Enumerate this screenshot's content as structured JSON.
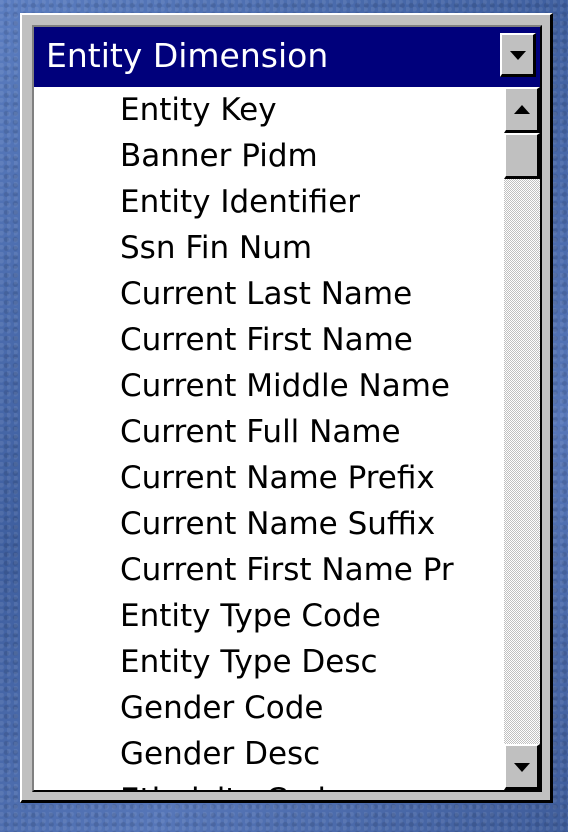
{
  "combo": {
    "selected": "Entity Dimension"
  },
  "list": {
    "items": [
      "Entity Key",
      "Banner Pidm",
      "Entity Identifier",
      "Ssn Fin Num",
      "Current Last Name",
      "Current First Name",
      "Current Middle Name",
      "Current Full Name",
      "Current Name Prefix",
      "Current Name Suffix",
      "Current First Name Pr",
      "Entity Type Code",
      "Entity Type Desc",
      "Gender Code",
      "Gender Desc",
      "Ethnicity Code"
    ]
  },
  "icons": {
    "dropdown": "chevron-down-icon",
    "scroll_up": "scroll-up-arrow-icon",
    "scroll_down": "scroll-down-arrow-icon"
  },
  "colors": {
    "selection_bg": "#00007b",
    "window_bg": "#c0c0c0",
    "desktop_bg": "#4a6cae"
  }
}
